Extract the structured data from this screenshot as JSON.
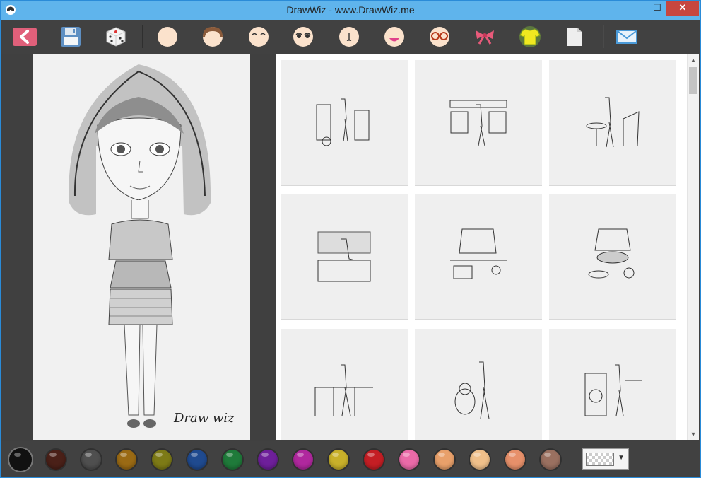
{
  "window": {
    "title": "DrawWiz - www.DrawWiz.me",
    "min": "—",
    "max": "☐",
    "close": "✕"
  },
  "toolbar": {
    "buttons": [
      {
        "name": "back-button",
        "icon": "back-arrow-icon"
      },
      {
        "name": "save-button",
        "icon": "floppy-disk-icon"
      },
      {
        "name": "random-button",
        "icon": "dice-icon"
      },
      {
        "name": "face-shape-button",
        "icon": "face-icon"
      },
      {
        "name": "hair-button",
        "icon": "hair-icon"
      },
      {
        "name": "eyebrows-button",
        "icon": "eyebrows-icon"
      },
      {
        "name": "eyes-button",
        "icon": "eyes-icon"
      },
      {
        "name": "nose-button",
        "icon": "nose-icon"
      },
      {
        "name": "mouth-button",
        "icon": "mouth-icon"
      },
      {
        "name": "glasses-button",
        "icon": "glasses-icon"
      },
      {
        "name": "accessories-button",
        "icon": "bow-icon"
      },
      {
        "name": "clothes-button",
        "icon": "shirt-icon"
      },
      {
        "name": "background-button",
        "icon": "page-icon"
      },
      {
        "name": "share-button",
        "icon": "envelope-icon"
      }
    ]
  },
  "canvas": {
    "signature": "Draw wiz"
  },
  "gallery": {
    "items": [
      "scene-closet",
      "scene-shop",
      "scene-cafe",
      "scene-bedroom",
      "scene-desk",
      "scene-dinner",
      "scene-bridge",
      "scene-dog",
      "scene-laundry"
    ]
  },
  "palette": {
    "colors": [
      "#111111",
      "#4a2018",
      "#4f4f4f",
      "#9a6a14",
      "#7d7a16",
      "#1f4a8f",
      "#1f7a3a",
      "#6e1f9a",
      "#b0289e",
      "#c8b02a",
      "#c41e24",
      "#ea6aa8",
      "#e8a06a",
      "#f0c08a",
      "#e7906a",
      "#9a7060"
    ],
    "selected": 0,
    "background_select": "transparent-pattern"
  }
}
